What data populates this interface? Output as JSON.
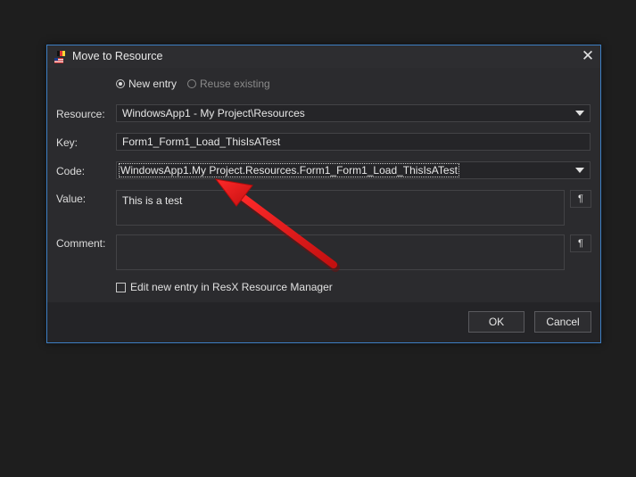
{
  "window": {
    "title": "Move to Resource",
    "close_icon": "close-icon"
  },
  "mode": {
    "new_entry_label": "New entry",
    "reuse_existing_label": "Reuse existing",
    "selected": "new_entry"
  },
  "fields": {
    "resource_label": "Resource:",
    "resource_value": "WindowsApp1 - My Project\\Resources",
    "key_label": "Key:",
    "key_value": "Form1_Form1_Load_ThisIsATest",
    "code_label": "Code:",
    "code_value": "WindowsApp1.My Project.Resources.Form1_Form1_Load_ThisIsATest",
    "value_label": "Value:",
    "value_value": "This is a test",
    "comment_label": "Comment:",
    "comment_value": "",
    "pilcrow": "¶"
  },
  "options": {
    "edit_in_manager_label": "Edit new entry in ResX Resource Manager",
    "edit_in_manager_checked": false
  },
  "buttons": {
    "ok_label": "OK",
    "cancel_label": "Cancel"
  },
  "colors": {
    "accent_border": "#3d7fc4",
    "annotation_arrow": "#e81c1c"
  }
}
